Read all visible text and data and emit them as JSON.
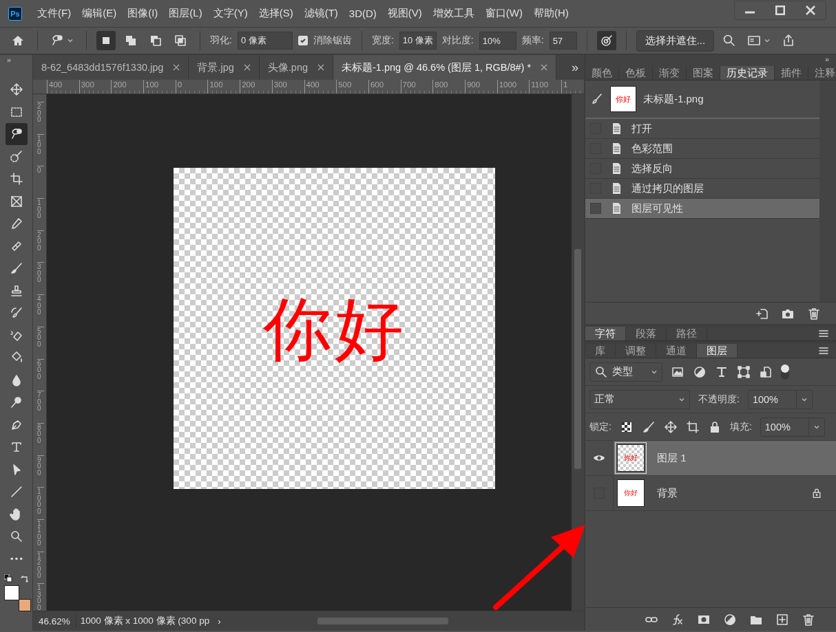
{
  "app_logo": "Ps",
  "menu_bar": {
    "items": [
      "文件(F)",
      "编辑(E)",
      "图像(I)",
      "图层(L)",
      "文字(Y)",
      "选择(S)",
      "滤镜(T)",
      "3D(D)",
      "视图(V)",
      "增效工具",
      "窗口(W)",
      "帮助(H)"
    ]
  },
  "options_bar": {
    "selection_modes": [
      {
        "kind": "new",
        "selected": true
      },
      {
        "kind": "add",
        "selected": false
      },
      {
        "kind": "subtract",
        "selected": false
      },
      {
        "kind": "intersect",
        "selected": false
      }
    ],
    "feather_label": "羽化:",
    "feather_value": "0 像素",
    "anti_alias": {
      "label": "消除锯齿",
      "checked": true
    },
    "width_label": "宽度:",
    "width_value": "10 像素",
    "contrast_label": "对比度:",
    "contrast_value": "10%",
    "frequency_label": "频率:",
    "frequency_value": "57",
    "pen_pressure": {
      "on": true
    },
    "select_mask_button": "选择并遮住..."
  },
  "panel_collapse": "»",
  "toolbar_collapse": "»",
  "document_tabs": [
    {
      "label": "8-62_6483dd1576f1330.jpg",
      "selected": false
    },
    {
      "label": "背景.jpg",
      "selected": false
    },
    {
      "label": "头像.png",
      "selected": false
    },
    {
      "label": "未标题-1.png @ 46.6% (图层 1, RGB/8#) *",
      "selected": true
    }
  ],
  "tabs_overflow": "»",
  "rulers": {
    "horizontal": [
      "400",
      "300",
      "200",
      "100",
      "0",
      "100",
      "200",
      "300",
      "400",
      "500",
      "600",
      "700",
      "800",
      "900",
      "1000",
      "1100",
      "1"
    ],
    "vertical": [
      "200",
      "100",
      "0",
      "100",
      "200",
      "300",
      "400",
      "500",
      "600",
      "700",
      "800",
      "900",
      "1000",
      "1100",
      "1200",
      "1300"
    ]
  },
  "canvas": {
    "text": "你好"
  },
  "toolbar": {
    "tools": [
      {
        "kind": "move",
        "selected": false
      },
      {
        "kind": "marquee",
        "selected": false
      },
      {
        "kind": "lasso",
        "selected": true
      },
      {
        "kind": "quick_select",
        "selected": false
      },
      {
        "kind": "crop",
        "selected": false
      },
      {
        "kind": "frame",
        "selected": false
      },
      {
        "kind": "eyedropper",
        "selected": false
      },
      {
        "kind": "healing",
        "selected": false
      },
      {
        "kind": "brush",
        "selected": false
      },
      {
        "kind": "stamp",
        "selected": false
      },
      {
        "kind": "history_brush",
        "selected": false
      },
      {
        "kind": "eraser",
        "selected": false
      },
      {
        "kind": "bucket",
        "selected": false
      },
      {
        "kind": "blur",
        "selected": false
      },
      {
        "kind": "dodge",
        "selected": false
      },
      {
        "kind": "pen",
        "selected": false
      },
      {
        "kind": "type",
        "selected": false
      },
      {
        "kind": "path_select",
        "selected": false
      },
      {
        "kind": "line",
        "selected": false
      },
      {
        "kind": "hand",
        "selected": false
      },
      {
        "kind": "zoom",
        "selected": false
      },
      {
        "kind": "more",
        "selected": false
      }
    ],
    "swatches": [
      {
        "color": "#ffffff"
      },
      {
        "color": "#e9a97b"
      }
    ]
  },
  "status_bar": {
    "zoom": "46.62%",
    "doc_info": "1000 像素 x 1000 像素 (300 pp",
    "caret": "›"
  },
  "history_panel": {
    "tabs": [
      {
        "label": "颜色",
        "selected": false
      },
      {
        "label": "色板",
        "selected": false
      },
      {
        "label": "渐变",
        "selected": false
      },
      {
        "label": "图案",
        "selected": false
      },
      {
        "label": "历史记录",
        "selected": true
      },
      {
        "label": "插件",
        "selected": false
      },
      {
        "label": "注释",
        "selected": false
      }
    ],
    "snapshot": {
      "label": "未标题-1.png",
      "thumb_text": "你好"
    },
    "states": [
      {
        "label": "打开",
        "selected": false
      },
      {
        "label": "色彩范围",
        "selected": false
      },
      {
        "label": "选择反向",
        "selected": false
      },
      {
        "label": "通过拷贝的图层",
        "selected": false
      },
      {
        "label": "图层可见性",
        "selected": true
      }
    ]
  },
  "character_panel": {
    "tabs": [
      {
        "label": "字符",
        "selected": true
      },
      {
        "label": "段落",
        "selected": false
      },
      {
        "label": "路径",
        "selected": false
      }
    ]
  },
  "layers_panel": {
    "tabs": [
      {
        "label": "库",
        "selected": false
      },
      {
        "label": "调整",
        "selected": false
      },
      {
        "label": "通道",
        "selected": false
      },
      {
        "label": "图层",
        "selected": true
      }
    ],
    "filter": "类型",
    "blend_mode": "正常",
    "opacity_label": "不透明度:",
    "opacity": "100%",
    "lock_label": "锁定:",
    "fill_label": "填充:",
    "fill": "100%",
    "layers": [
      {
        "name": "图层 1",
        "visible": true,
        "selected": true,
        "transparent": true,
        "locked": false,
        "thumb_text": "你好"
      },
      {
        "name": "背景",
        "visible": false,
        "selected": false,
        "transparent": false,
        "locked": true,
        "thumb_text": "你好"
      }
    ]
  }
}
